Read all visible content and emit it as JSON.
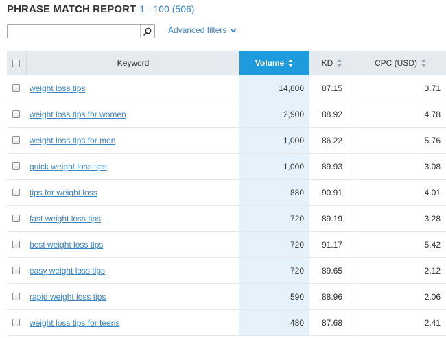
{
  "header": {
    "title": "PHRASE MATCH REPORT",
    "range": "1 - 100 (506)"
  },
  "search": {
    "value": "",
    "placeholder": ""
  },
  "filters": {
    "advanced_label": "Advanced filters"
  },
  "table": {
    "columns": {
      "keyword": "Keyword",
      "volume": "Volume",
      "kd": "KD",
      "cpc": "CPC (USD)"
    },
    "sorted_column": "volume",
    "rows": [
      {
        "keyword": "weight loss tips",
        "volume": "14,800",
        "kd": "87.15",
        "cpc": "3.71"
      },
      {
        "keyword": "weight loss tips for women",
        "volume": "2,900",
        "kd": "88.92",
        "cpc": "4.78"
      },
      {
        "keyword": "weight loss tips for men",
        "volume": "1,000",
        "kd": "86.22",
        "cpc": "5.76"
      },
      {
        "keyword": "quick weight loss tips",
        "volume": "1,000",
        "kd": "89.93",
        "cpc": "3.08"
      },
      {
        "keyword": "tips for weight loss",
        "volume": "880",
        "kd": "90.91",
        "cpc": "4.01"
      },
      {
        "keyword": "fast weight loss tips",
        "volume": "720",
        "kd": "89.19",
        "cpc": "3.28"
      },
      {
        "keyword": "best weight loss tips",
        "volume": "720",
        "kd": "91.17",
        "cpc": "5.42"
      },
      {
        "keyword": "easy weight loss tips",
        "volume": "720",
        "kd": "89.65",
        "cpc": "2.12"
      },
      {
        "keyword": "rapid weight loss tips",
        "volume": "590",
        "kd": "88.96",
        "cpc": "2.06"
      },
      {
        "keyword": "weight loss tips for teens",
        "volume": "480",
        "kd": "87.68",
        "cpc": "2.41"
      }
    ]
  },
  "icons": {
    "search": "search-icon",
    "filter_toggle": "chevron-down-icon",
    "sort": "sort-arrows-icon"
  },
  "colors": {
    "accent": "#1e9bdc",
    "link": "#3a86c8",
    "header_bg": "#e5eaee",
    "sorted_column_bg": "#e6f2fb"
  }
}
